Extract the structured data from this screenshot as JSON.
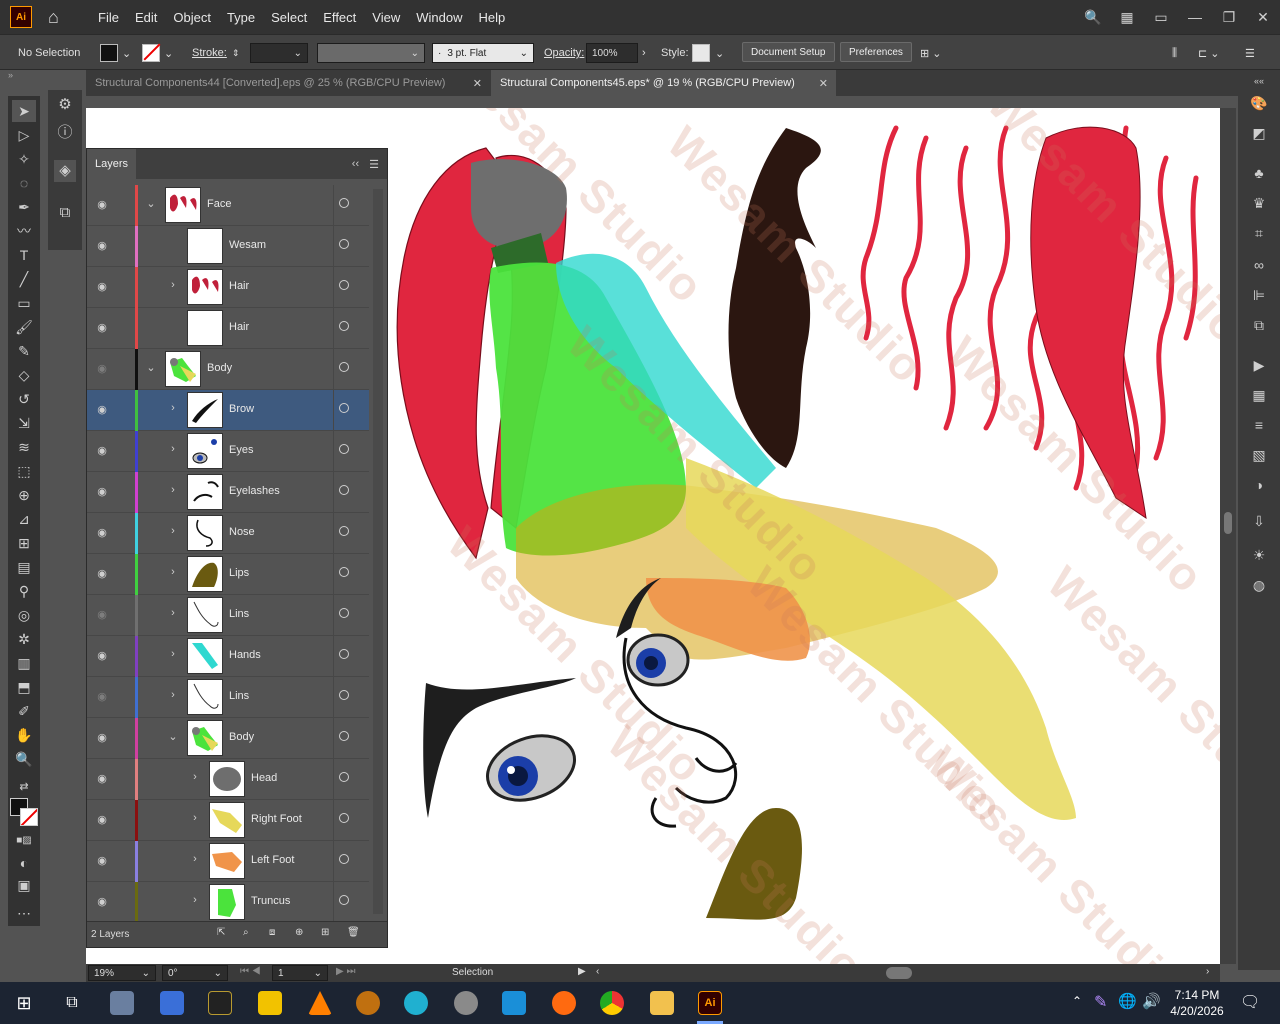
{
  "app": {
    "logo": "Ai",
    "menus": [
      "File",
      "Edit",
      "Object",
      "Type",
      "Select",
      "Effect",
      "View",
      "Window",
      "Help"
    ]
  },
  "control": {
    "selection": "No Selection",
    "stroke_label": "Stroke:",
    "brush": "3 pt. Flat",
    "opacity_label": "Opacity:",
    "opacity_value": "100%",
    "style_label": "Style:",
    "doc_setup": "Document Setup",
    "preferences": "Preferences"
  },
  "tabs": [
    {
      "label": "Structural Components44 [Converted].eps @ 25 % (RGB/CPU Preview)",
      "active": false
    },
    {
      "label": "Structural Components45.eps* @ 19 % (RGB/CPU Preview)",
      "active": true
    }
  ],
  "layers_panel": {
    "title": "Layers",
    "footer": "2 Layers",
    "rows": [
      {
        "name": "Face",
        "color": "#e04848",
        "level": 0,
        "expanded": true,
        "visible": true,
        "selected": false,
        "thumb": "hair"
      },
      {
        "name": "Wesam",
        "color": "#e070c0",
        "level": 1,
        "expanded": null,
        "visible": true,
        "selected": false,
        "thumb": "blank"
      },
      {
        "name": "Hair",
        "color": "#e04848",
        "level": 1,
        "expanded": false,
        "visible": true,
        "selected": false,
        "thumb": "hair"
      },
      {
        "name": "Hair",
        "color": "#e04848",
        "level": 1,
        "expanded": null,
        "visible": true,
        "selected": false,
        "thumb": "blank"
      },
      {
        "name": "Body",
        "color": "#101010",
        "level": 0,
        "expanded": true,
        "visible": false,
        "selected": false,
        "thumb": "body"
      },
      {
        "name": "Brow",
        "color": "#40c040",
        "level": 1,
        "expanded": false,
        "visible": true,
        "selected": true,
        "thumb": "brow"
      },
      {
        "name": "Eyes",
        "color": "#4040d0",
        "level": 1,
        "expanded": false,
        "visible": true,
        "selected": false,
        "thumb": "eyes"
      },
      {
        "name": "Eyelashes",
        "color": "#d040d0",
        "level": 1,
        "expanded": false,
        "visible": true,
        "selected": false,
        "thumb": "lash"
      },
      {
        "name": "Nose",
        "color": "#40d0e0",
        "level": 1,
        "expanded": false,
        "visible": true,
        "selected": false,
        "thumb": "nose"
      },
      {
        "name": "Lips",
        "color": "#40d040",
        "level": 1,
        "expanded": false,
        "visible": true,
        "selected": false,
        "thumb": "lips"
      },
      {
        "name": "Lins",
        "color": "#707070",
        "level": 1,
        "expanded": false,
        "visible": false,
        "selected": false,
        "thumb": "lines"
      },
      {
        "name": "Hands",
        "color": "#8040c0",
        "level": 1,
        "expanded": false,
        "visible": true,
        "selected": false,
        "thumb": "hands"
      },
      {
        "name": "Lins",
        "color": "#4070d0",
        "level": 1,
        "expanded": false,
        "visible": false,
        "selected": false,
        "thumb": "lines"
      },
      {
        "name": "Body",
        "color": "#d040a0",
        "level": 1,
        "expanded": true,
        "visible": true,
        "selected": false,
        "thumb": "body"
      },
      {
        "name": "Head",
        "color": "#e08080",
        "level": 2,
        "expanded": false,
        "visible": true,
        "selected": false,
        "thumb": "head"
      },
      {
        "name": "Right Foot",
        "color": "#8a1010",
        "level": 2,
        "expanded": false,
        "visible": true,
        "selected": false,
        "thumb": "rfoot"
      },
      {
        "name": "Left Foot",
        "color": "#8a80e0",
        "level": 2,
        "expanded": false,
        "visible": true,
        "selected": false,
        "thumb": "lfoot"
      },
      {
        "name": "Truncus",
        "color": "#6a6a10",
        "level": 2,
        "expanded": false,
        "visible": true,
        "selected": false,
        "thumb": "trunk"
      }
    ]
  },
  "status": {
    "zoom": "19%",
    "rotation": "0°",
    "artboard": "1",
    "tool": "Selection"
  },
  "taskbar": {
    "time": "7:14 PM",
    "date": "4/20/2026"
  },
  "watermark": "Wesam Studio",
  "colors": {
    "accent_selected_row": "#3e5a7f",
    "hair": "#e0263f",
    "dark_hair": "#2b1610",
    "torso": "#4be33c",
    "arm": "#2fd8d0",
    "leg": "#e6d85a",
    "lips": "#6a5a10"
  }
}
